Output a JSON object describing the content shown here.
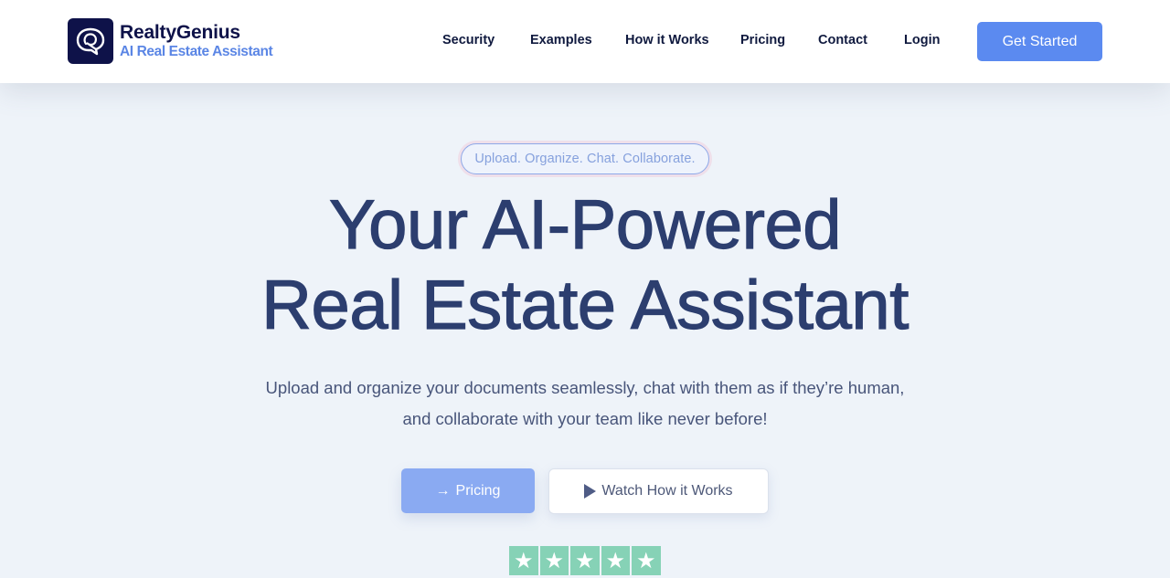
{
  "header": {
    "brand_name": "RealtyGenius",
    "brand_tagline": "AI Real Estate Assistant",
    "nav": [
      {
        "label": "Security"
      },
      {
        "label": "Examples"
      },
      {
        "label": "How it Works"
      },
      {
        "label": "Pricing"
      },
      {
        "label": "Contact"
      },
      {
        "label": "Login"
      }
    ],
    "cta_label": "Get Started"
  },
  "hero": {
    "tagline": "Upload. Organize. Chat. Collaborate.",
    "title_line1": "Your AI-Powered",
    "title_line2": "Real Estate Assistant",
    "subtitle": "Upload and organize your documents seamlessly, chat with them as if they’re human, and collaborate with your team like never before!",
    "primary_button": {
      "icon": "arrow-right-icon",
      "label": "Pricing"
    },
    "secondary_button": {
      "icon": "play-icon",
      "label": "Watch How it Works"
    },
    "rating": {
      "stars": 5,
      "max": 5,
      "star_color": "#86d2b6"
    }
  },
  "colors": {
    "brand_dark": "#0e1249",
    "accent": "#5b8af0",
    "heading": "#2c3e6f",
    "background": "#eef3f9"
  }
}
